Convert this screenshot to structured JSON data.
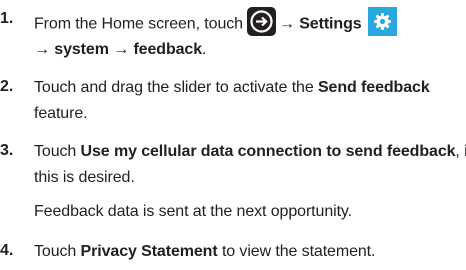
{
  "steps": [
    {
      "number": "1.",
      "line1": {
        "pre": "From the Home screen, touch",
        "arrow1": "→",
        "settings": "Settings"
      },
      "line2": {
        "arrow2": "→",
        "system": "system",
        "arrow3": "→",
        "feedback": "feedback",
        "end": "."
      }
    },
    {
      "number": "2.",
      "line1": {
        "pre": "Touch and drag the slider to activate the ",
        "bold": "Send feedback"
      },
      "line2": {
        "text": "feature."
      }
    },
    {
      "number": "3.",
      "line1": {
        "pre": "Touch ",
        "bold": "Use my cellular data connection to send feedback",
        "post": ", if"
      },
      "line2": {
        "text": "this is desired."
      },
      "note": "Feedback data is sent at the next opportunity."
    },
    {
      "number": "4.",
      "line1": {
        "pre": "Touch ",
        "bold": "Privacy Statement",
        "post": " to view the statement."
      }
    }
  ],
  "icons": {
    "arrow": "arrow-circle-icon",
    "settings": "settings-gear-icon",
    "arrow_icon_bg": "#231f20",
    "settings_icon_bg": "#29a8e0"
  }
}
